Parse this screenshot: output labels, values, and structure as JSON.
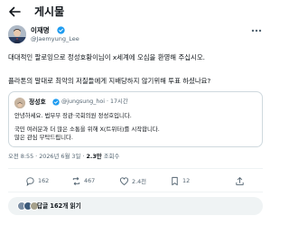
{
  "header": {
    "title": "게시물"
  },
  "post": {
    "author_name": "이재명",
    "author_handle": "@Jaemyung_Lee",
    "text_line1": "대대적인 팔로잉으로 정성호황이님이 x세계에 오심을 환영해 주십시오.",
    "text_line2": "플라톤의 말대로 최악의 저질들에게 지배당하지 않기위해 투표 하셨나요?",
    "meta_time": "오전 8:55 · 2026년 6월 3일 ·",
    "meta_views": "2.3만",
    "meta_views_label": "조회수"
  },
  "quote": {
    "author_name": "정성호",
    "author_meta": "@jungsung_hoi · 17시간",
    "line1": "안녕하세요. 법무부 장관·국회의원 정성호입니다.",
    "line2": "국민 여러분과 더 많은 소통을 위해 X(트위터)를 시작합니다.",
    "line3": "많은 관심 부탁드립니다."
  },
  "actions": {
    "replies": "162",
    "reposts": "467",
    "likes": "2.4천",
    "bookmarks": "12"
  },
  "reply_button": {
    "label": "답글 162개 읽기"
  },
  "colors": {
    "verified": "#1d9bf0",
    "secondary_text": "#536471",
    "border": "#cfd9de"
  }
}
